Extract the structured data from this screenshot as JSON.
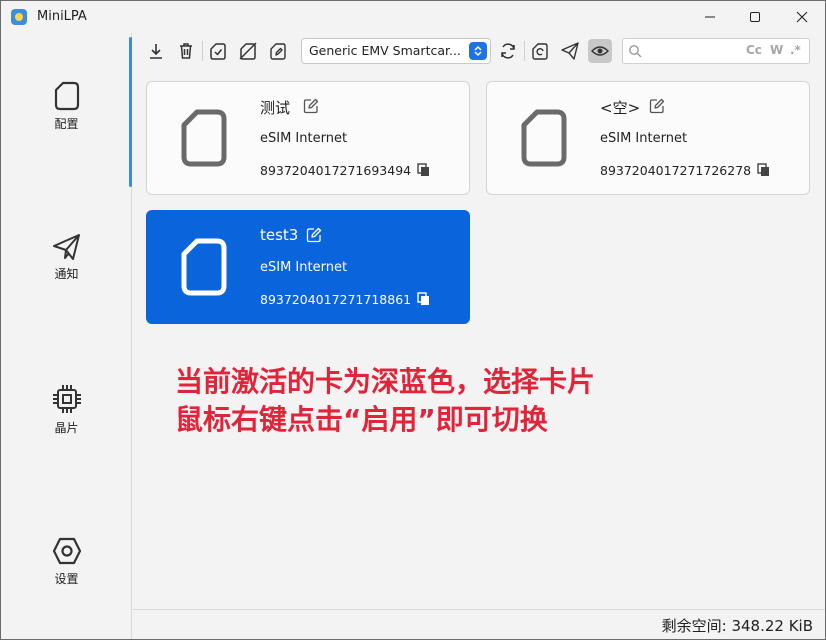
{
  "window": {
    "title": "MiniLPA"
  },
  "sidebar": {
    "items": [
      {
        "label": "配置",
        "icon": "sim-card-icon"
      },
      {
        "label": "通知",
        "icon": "paper-plane-icon"
      },
      {
        "label": "晶片",
        "icon": "chip-icon"
      },
      {
        "label": "设置",
        "icon": "gear-icon"
      }
    ],
    "accent": "#3c8de0"
  },
  "toolbar": {
    "device": "Generic EMV Smartcar...",
    "search": {
      "placeholder": "",
      "value": "",
      "case_label": "Cc",
      "word_label": "W",
      "regex_label": ".*"
    }
  },
  "profiles": [
    {
      "name": "测试",
      "provider": "eSIM Internet",
      "iccid": "8937204017271693494",
      "active": false
    },
    {
      "name": "<空>",
      "provider": "eSIM Internet",
      "iccid": "8937204017271726278",
      "active": false
    },
    {
      "name": "test3",
      "provider": "eSIM Internet",
      "iccid": "8937204017271718861",
      "active": true
    }
  ],
  "annotation": {
    "line1": "当前激活的卡为深蓝色，选择卡片",
    "line2": "鼠标右键点击“启用”即可切换",
    "color": "#e0243a"
  },
  "status": {
    "free_space": "剩余空间: 348.22 KiB"
  },
  "colors": {
    "active_card": "#0a64dc"
  }
}
